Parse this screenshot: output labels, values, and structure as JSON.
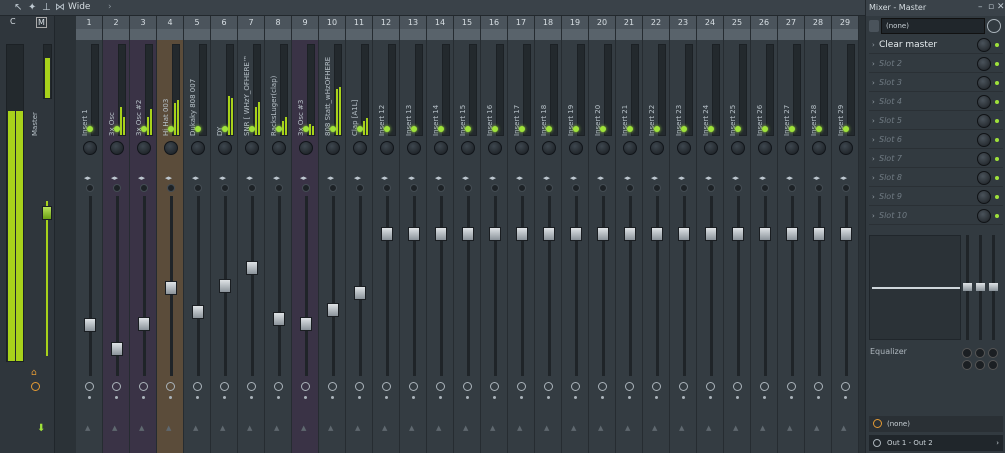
{
  "toolbar": {
    "view_label": "Wide",
    "icons": [
      "pointer-icon",
      "eraser-icon",
      "pin-icon",
      "link-icon",
      "wide-layout-icon"
    ]
  },
  "mixer": {
    "master_letters": {
      "c": "C",
      "m": "M"
    },
    "master_name": "Master",
    "tracks": [
      {
        "num": "1",
        "name": "Insert 1",
        "theme": "normal",
        "meter": [
          0,
          0
        ],
        "fader": 0.72
      },
      {
        "num": "2",
        "name": "3x Osc",
        "theme": "purple",
        "meter": [
          0.3,
          0.2
        ],
        "fader": 0.86
      },
      {
        "num": "3",
        "name": "3x Osc #2",
        "theme": "purple",
        "meter": [
          0.2,
          0.28
        ],
        "fader": 0.71
      },
      {
        "num": "4",
        "name": "Hi Hat 003",
        "theme": "brown",
        "meter": [
          0.35,
          0.38
        ],
        "fader": 0.5
      },
      {
        "num": "5",
        "name": "Dukaky 808 007",
        "theme": "normal",
        "meter": [
          0,
          0
        ],
        "fader": 0.64
      },
      {
        "num": "6",
        "name": "DY",
        "theme": "normal",
        "meter": [
          0.42,
          0.4
        ],
        "fader": 0.49
      },
      {
        "num": "7",
        "name": "SNR [ WHzY_OFHERE™ ]",
        "theme": "normal",
        "meter": [
          0.3,
          0.36
        ],
        "fader": 0.38
      },
      {
        "num": "8",
        "name": "RacksLuger(clap)",
        "theme": "normal",
        "meter": [
          0.15,
          0.2
        ],
        "fader": 0.68
      },
      {
        "num": "9",
        "name": "3x Osc #3",
        "theme": "purple",
        "meter": [
          0.12,
          0.1
        ],
        "fader": 0.71
      },
      {
        "num": "10",
        "name": "808 Statt_wHzOFHERE™",
        "theme": "normal",
        "meter": [
          0.5,
          0.52
        ],
        "fader": 0.63
      },
      {
        "num": "11",
        "name": "Clap [A1L]",
        "theme": "normal",
        "meter": [
          0.15,
          0.18
        ],
        "fader": 0.53
      },
      {
        "num": "12",
        "name": "Insert 12",
        "theme": "normal",
        "meter": [
          0,
          0
        ],
        "fader": 0.18
      },
      {
        "num": "13",
        "name": "Insert 13",
        "theme": "normal",
        "meter": [
          0,
          0
        ],
        "fader": 0.18
      },
      {
        "num": "14",
        "name": "Insert 14",
        "theme": "normal",
        "meter": [
          0,
          0
        ],
        "fader": 0.18
      },
      {
        "num": "15",
        "name": "Insert 15",
        "theme": "normal",
        "meter": [
          0,
          0
        ],
        "fader": 0.18
      },
      {
        "num": "16",
        "name": "Insert 16",
        "theme": "normal",
        "meter": [
          0,
          0
        ],
        "fader": 0.18
      },
      {
        "num": "17",
        "name": "Insert 17",
        "theme": "normal",
        "meter": [
          0,
          0
        ],
        "fader": 0.18
      },
      {
        "num": "18",
        "name": "Insert 18",
        "theme": "normal",
        "meter": [
          0,
          0
        ],
        "fader": 0.18
      },
      {
        "num": "19",
        "name": "Insert 19",
        "theme": "normal",
        "meter": [
          0,
          0
        ],
        "fader": 0.18
      },
      {
        "num": "20",
        "name": "Insert 20",
        "theme": "normal",
        "meter": [
          0,
          0
        ],
        "fader": 0.18
      },
      {
        "num": "21",
        "name": "Insert 21",
        "theme": "normal",
        "meter": [
          0,
          0
        ],
        "fader": 0.18
      },
      {
        "num": "22",
        "name": "Insert 22",
        "theme": "normal",
        "meter": [
          0,
          0
        ],
        "fader": 0.18
      },
      {
        "num": "23",
        "name": "Insert 23",
        "theme": "normal",
        "meter": [
          0,
          0
        ],
        "fader": 0.18
      },
      {
        "num": "24",
        "name": "Insert 24",
        "theme": "normal",
        "meter": [
          0,
          0
        ],
        "fader": 0.18
      },
      {
        "num": "25",
        "name": "Insert 25",
        "theme": "normal",
        "meter": [
          0,
          0
        ],
        "fader": 0.18
      },
      {
        "num": "26",
        "name": "Insert 26",
        "theme": "normal",
        "meter": [
          0,
          0
        ],
        "fader": 0.18
      },
      {
        "num": "27",
        "name": "Insert 27",
        "theme": "normal",
        "meter": [
          0,
          0
        ],
        "fader": 0.18
      },
      {
        "num": "28",
        "name": "Insert 28",
        "theme": "normal",
        "meter": [
          0,
          0
        ],
        "fader": 0.18
      },
      {
        "num": "29",
        "name": "Insert 29",
        "theme": "normal",
        "meter": [
          0,
          0
        ],
        "fader": 0.18
      }
    ]
  },
  "side": {
    "title": "Mixer - Master",
    "top_select": "(none)",
    "slots": [
      "Clear master",
      "Slot 2",
      "Slot 3",
      "Slot 4",
      "Slot 5",
      "Slot 6",
      "Slot 7",
      "Slot 8",
      "Slot 9",
      "Slot 10"
    ],
    "eq_label": "Equalizer",
    "bottom_select": "(none)",
    "output": "Out 1 - Out 2"
  }
}
